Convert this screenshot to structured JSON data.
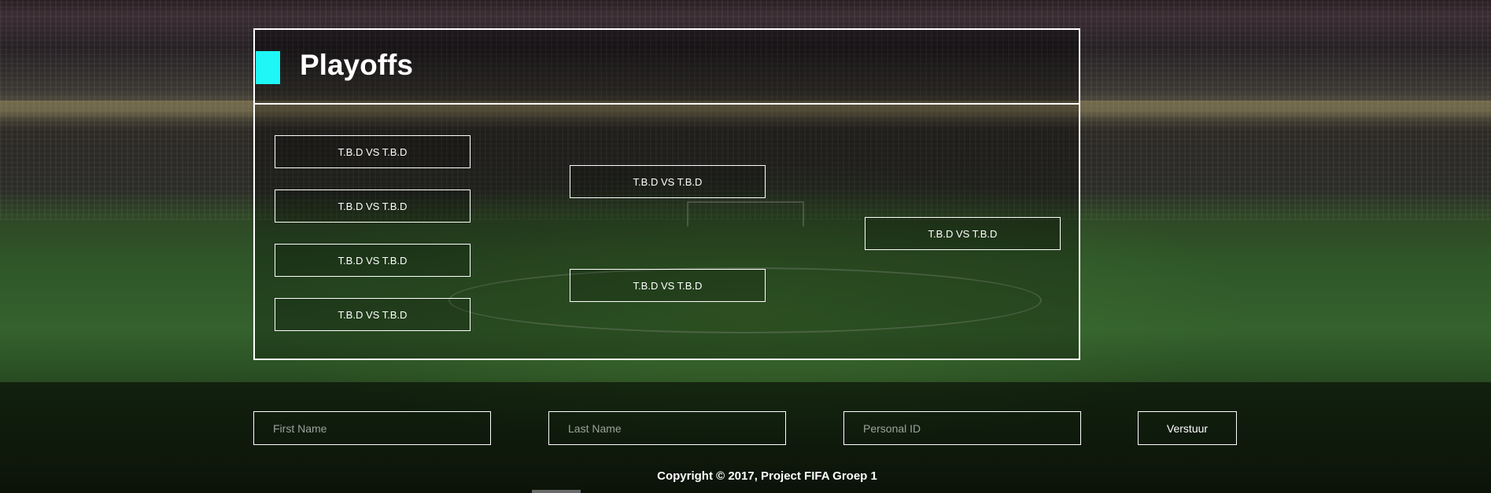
{
  "page": {
    "title": "Playoffs",
    "accent_color": "#1ff7f7"
  },
  "bracket": {
    "round1": [
      {
        "label": "T.B.D VS T.B.D"
      },
      {
        "label": "T.B.D VS T.B.D"
      },
      {
        "label": "T.B.D VS T.B.D"
      },
      {
        "label": "T.B.D VS T.B.D"
      }
    ],
    "round2": [
      {
        "label": "T.B.D VS T.B.D"
      },
      {
        "label": "T.B.D VS T.B.D"
      }
    ],
    "final": {
      "label": "T.B.D VS T.B.D"
    }
  },
  "form": {
    "first_name_placeholder": "First Name",
    "last_name_placeholder": "Last Name",
    "personal_id_placeholder": "Personal ID",
    "submit_label": "Verstuur"
  },
  "footer": {
    "copyright": "Copyright © 2017, Project FIFA Groep 1"
  }
}
